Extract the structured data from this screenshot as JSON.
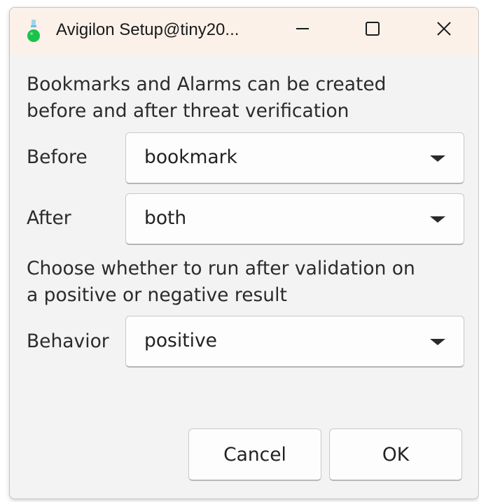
{
  "window": {
    "title": "Avigilon Setup@tiny20...",
    "app_icon": "flask-icon",
    "accent": "#19c24a",
    "titlebar_bg": "#fbf1e9"
  },
  "controls": {
    "minimize": "minimize-icon",
    "maximize": "maximize-icon",
    "close": "close-icon"
  },
  "section1": {
    "line1": "Bookmarks and Alarms can be created",
    "line2": "before and after threat verification"
  },
  "before": {
    "label": "Before",
    "value": "bookmark"
  },
  "after": {
    "label": "After",
    "value": "both"
  },
  "section2": {
    "line1": "Choose whether to run after validation on",
    "line2": "a positive or negative result"
  },
  "behavior": {
    "label": "Behavior",
    "value": "positive"
  },
  "buttons": {
    "cancel": "Cancel",
    "ok": "OK"
  }
}
